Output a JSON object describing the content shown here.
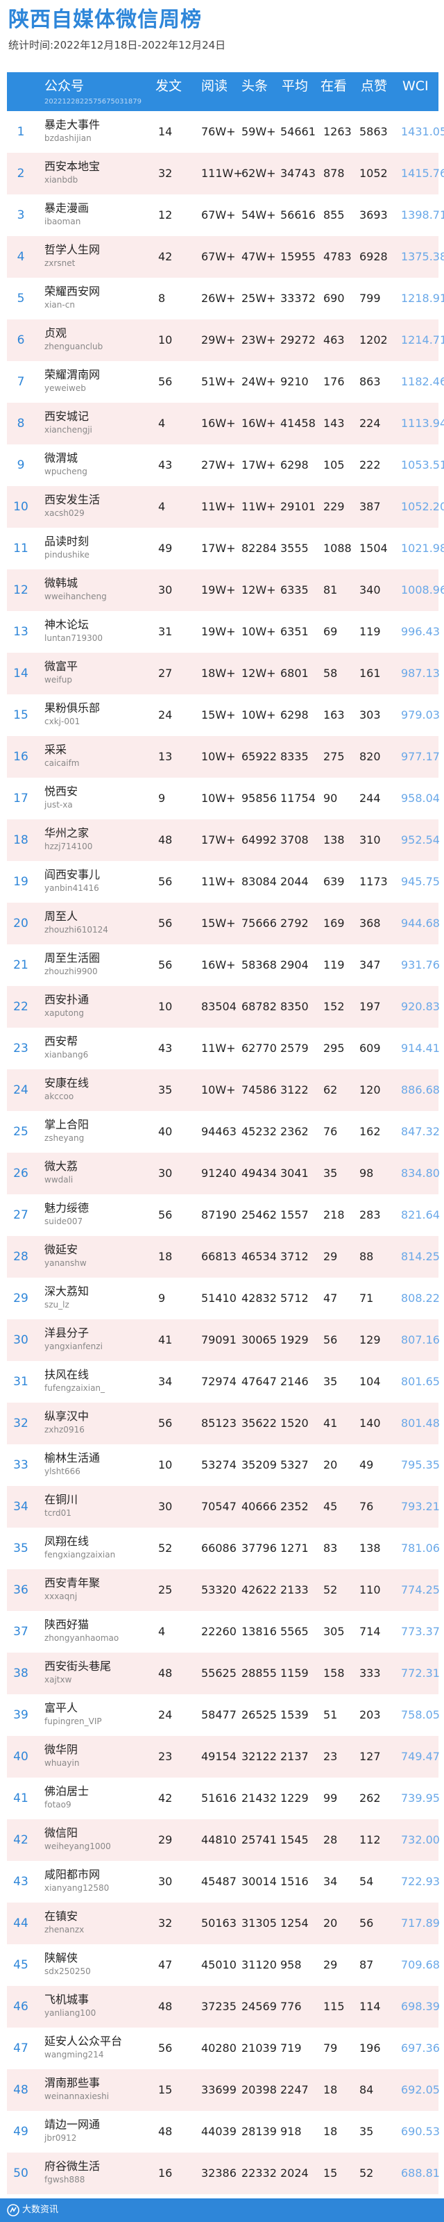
{
  "title": "陕西自媒体微信周榜",
  "subtitle": "统计时间:2022年12月18日-2022年12月24日",
  "header": {
    "account": "公众号",
    "account_sub": "2022122822575675031879",
    "post": "发文",
    "read": "阅读",
    "head": "头条",
    "avg": "平均",
    "like": "在看",
    "zan": "点赞",
    "wci": "WCI"
  },
  "rows": [
    {
      "rank": "1",
      "name": "暴走大事件",
      "id": "bzdashijian",
      "post": "14",
      "read": "76W+",
      "head": "59W+",
      "avg": "54661",
      "like": "1263",
      "zan": "5863",
      "wci": "1431.05"
    },
    {
      "rank": "2",
      "name": "西安本地宝",
      "id": "xianbdb",
      "post": "32",
      "read": "111W+",
      "head": "62W+",
      "avg": "34743",
      "like": "878",
      "zan": "1052",
      "wci": "1415.76"
    },
    {
      "rank": "3",
      "name": "暴走漫画",
      "id": "ibaoman",
      "post": "12",
      "read": "67W+",
      "head": "54W+",
      "avg": "56616",
      "like": "855",
      "zan": "3693",
      "wci": "1398.71"
    },
    {
      "rank": "4",
      "name": "哲学人生网",
      "id": "zxrsnet",
      "post": "42",
      "read": "67W+",
      "head": "47W+",
      "avg": "15955",
      "like": "4783",
      "zan": "6928",
      "wci": "1375.38"
    },
    {
      "rank": "5",
      "name": "荣耀西安网",
      "id": "xian-cn",
      "post": "8",
      "read": "26W+",
      "head": "25W+",
      "avg": "33372",
      "like": "690",
      "zan": "799",
      "wci": "1218.91"
    },
    {
      "rank": "6",
      "name": "贞观",
      "id": "zhenguanclub",
      "post": "10",
      "read": "29W+",
      "head": "23W+",
      "avg": "29272",
      "like": "463",
      "zan": "1202",
      "wci": "1214.71"
    },
    {
      "rank": "7",
      "name": "荣耀渭南网",
      "id": "yeweiweb",
      "post": "56",
      "read": "51W+",
      "head": "24W+",
      "avg": "9210",
      "like": "176",
      "zan": "863",
      "wci": "1182.46"
    },
    {
      "rank": "8",
      "name": "西安城记",
      "id": "xianchengji",
      "post": "4",
      "read": "16W+",
      "head": "16W+",
      "avg": "41458",
      "like": "143",
      "zan": "224",
      "wci": "1113.94"
    },
    {
      "rank": "9",
      "name": "微渭城",
      "id": "wpucheng",
      "post": "43",
      "read": "27W+",
      "head": "17W+",
      "avg": "6298",
      "like": "105",
      "zan": "222",
      "wci": "1053.51"
    },
    {
      "rank": "10",
      "name": "西安发生活",
      "id": "xacsh029",
      "post": "4",
      "read": "11W+",
      "head": "11W+",
      "avg": "29101",
      "like": "229",
      "zan": "387",
      "wci": "1052.20"
    },
    {
      "rank": "11",
      "name": "品读时刻",
      "id": "pindushike",
      "post": "49",
      "read": "17W+",
      "head": "82284",
      "avg": "3555",
      "like": "1088",
      "zan": "1504",
      "wci": "1021.98"
    },
    {
      "rank": "12",
      "name": "微韩城",
      "id": "wweihancheng",
      "post": "30",
      "read": "19W+",
      "head": "12W+",
      "avg": "6335",
      "like": "81",
      "zan": "340",
      "wci": "1008.96"
    },
    {
      "rank": "13",
      "name": "神木论坛",
      "id": "luntan719300",
      "post": "31",
      "read": "19W+",
      "head": "10W+",
      "avg": "6351",
      "like": "69",
      "zan": "119",
      "wci": "996.43"
    },
    {
      "rank": "14",
      "name": "微富平",
      "id": "weifup",
      "post": "27",
      "read": "18W+",
      "head": "12W+",
      "avg": "6801",
      "like": "58",
      "zan": "161",
      "wci": "987.13"
    },
    {
      "rank": "15",
      "name": "果粉俱乐部",
      "id": "cxkj-001",
      "post": "24",
      "read": "15W+",
      "head": "10W+",
      "avg": "6298",
      "like": "163",
      "zan": "303",
      "wci": "979.03"
    },
    {
      "rank": "16",
      "name": "采采",
      "id": "caicaifm",
      "post": "13",
      "read": "10W+",
      "head": "65922",
      "avg": "8335",
      "like": "275",
      "zan": "820",
      "wci": "977.17"
    },
    {
      "rank": "17",
      "name": "悦西安",
      "id": "just-xa",
      "post": "9",
      "read": "10W+",
      "head": "95856",
      "avg": "11754",
      "like": "90",
      "zan": "244",
      "wci": "958.04"
    },
    {
      "rank": "18",
      "name": "华州之家",
      "id": "hzzj714100",
      "post": "48",
      "read": "17W+",
      "head": "64992",
      "avg": "3708",
      "like": "138",
      "zan": "310",
      "wci": "952.54"
    },
    {
      "rank": "19",
      "name": "阎西安事儿",
      "id": "yanbin41416",
      "post": "56",
      "read": "11W+",
      "head": "83084",
      "avg": "2044",
      "like": "639",
      "zan": "1173",
      "wci": "945.75"
    },
    {
      "rank": "20",
      "name": "周至人",
      "id": "zhouzhi610124",
      "post": "56",
      "read": "15W+",
      "head": "75666",
      "avg": "2792",
      "like": "169",
      "zan": "368",
      "wci": "944.68"
    },
    {
      "rank": "21",
      "name": "周至生活圈",
      "id": "zhouzhi9900",
      "post": "56",
      "read": "16W+",
      "head": "58368",
      "avg": "2904",
      "like": "119",
      "zan": "347",
      "wci": "931.76"
    },
    {
      "rank": "22",
      "name": "西安扑通",
      "id": "xaputong",
      "post": "10",
      "read": "83504",
      "head": "68782",
      "avg": "8350",
      "like": "152",
      "zan": "197",
      "wci": "920.83"
    },
    {
      "rank": "23",
      "name": "西安帮",
      "id": "xianbang6",
      "post": "43",
      "read": "11W+",
      "head": "62770",
      "avg": "2579",
      "like": "295",
      "zan": "609",
      "wci": "914.41"
    },
    {
      "rank": "24",
      "name": "安康在线",
      "id": "akccoo",
      "post": "35",
      "read": "10W+",
      "head": "74586",
      "avg": "3122",
      "like": "62",
      "zan": "120",
      "wci": "886.68"
    },
    {
      "rank": "25",
      "name": "掌上合阳",
      "id": "zsheyang",
      "post": "40",
      "read": "94463",
      "head": "45232",
      "avg": "2362",
      "like": "76",
      "zan": "162",
      "wci": "847.32"
    },
    {
      "rank": "26",
      "name": "微大荔",
      "id": "wwdali",
      "post": "30",
      "read": "91240",
      "head": "49434",
      "avg": "3041",
      "like": "35",
      "zan": "98",
      "wci": "834.80"
    },
    {
      "rank": "27",
      "name": "魅力绥德",
      "id": "suide007",
      "post": "56",
      "read": "87190",
      "head": "25462",
      "avg": "1557",
      "like": "218",
      "zan": "283",
      "wci": "821.64"
    },
    {
      "rank": "28",
      "name": "微延安",
      "id": "yananshw",
      "post": "18",
      "read": "66813",
      "head": "46534",
      "avg": "3712",
      "like": "29",
      "zan": "88",
      "wci": "814.25"
    },
    {
      "rank": "29",
      "name": "深大荔知",
      "id": "szu_lz",
      "post": "9",
      "read": "51410",
      "head": "42832",
      "avg": "5712",
      "like": "47",
      "zan": "71",
      "wci": "808.22"
    },
    {
      "rank": "30",
      "name": "洋县分子",
      "id": "yangxianfenzi",
      "post": "41",
      "read": "79091",
      "head": "30065",
      "avg": "1929",
      "like": "56",
      "zan": "129",
      "wci": "807.16"
    },
    {
      "rank": "31",
      "name": "扶风在线",
      "id": "fufengzaixian_",
      "post": "34",
      "read": "72974",
      "head": "47647",
      "avg": "2146",
      "like": "35",
      "zan": "104",
      "wci": "801.65"
    },
    {
      "rank": "32",
      "name": "纵享汉中",
      "id": "zxhz0916",
      "post": "56",
      "read": "85123",
      "head": "35622",
      "avg": "1520",
      "like": "41",
      "zan": "140",
      "wci": "801.48"
    },
    {
      "rank": "33",
      "name": "榆林生活通",
      "id": "ylsht666",
      "post": "10",
      "read": "53274",
      "head": "35209",
      "avg": "5327",
      "like": "20",
      "zan": "49",
      "wci": "795.35"
    },
    {
      "rank": "34",
      "name": "在铜川",
      "id": "tcrd01",
      "post": "30",
      "read": "70547",
      "head": "40666",
      "avg": "2352",
      "like": "45",
      "zan": "76",
      "wci": "793.21"
    },
    {
      "rank": "35",
      "name": "凤翔在线",
      "id": "fengxiangzaixian",
      "post": "52",
      "read": "66086",
      "head": "37796",
      "avg": "1271",
      "like": "83",
      "zan": "138",
      "wci": "781.06"
    },
    {
      "rank": "36",
      "name": "西安青年聚",
      "id": "xxxaqnj",
      "post": "25",
      "read": "53320",
      "head": "42622",
      "avg": "2133",
      "like": "52",
      "zan": "110",
      "wci": "774.25"
    },
    {
      "rank": "37",
      "name": "陕西好猫",
      "id": "zhongyanhaomao",
      "post": "4",
      "read": "22260",
      "head": "13816",
      "avg": "5565",
      "like": "305",
      "zan": "714",
      "wci": "773.37"
    },
    {
      "rank": "38",
      "name": "西安街头巷尾",
      "id": "xajtxw",
      "post": "48",
      "read": "55625",
      "head": "28855",
      "avg": "1159",
      "like": "158",
      "zan": "333",
      "wci": "772.31"
    },
    {
      "rank": "39",
      "name": "富平人",
      "id": "fupingren_VIP",
      "post": "24",
      "read": "58477",
      "head": "26525",
      "avg": "1539",
      "like": "51",
      "zan": "203",
      "wci": "758.05"
    },
    {
      "rank": "40",
      "name": "微华阴",
      "id": "whuayin",
      "post": "23",
      "read": "49154",
      "head": "32122",
      "avg": "2137",
      "like": "23",
      "zan": "127",
      "wci": "749.47"
    },
    {
      "rank": "41",
      "name": "佛泊居士",
      "id": "fotao9",
      "post": "42",
      "read": "51616",
      "head": "21432",
      "avg": "1229",
      "like": "99",
      "zan": "262",
      "wci": "739.95"
    },
    {
      "rank": "42",
      "name": "微信阳",
      "id": "weiheyang1000",
      "post": "29",
      "read": "44810",
      "head": "25741",
      "avg": "1545",
      "like": "28",
      "zan": "112",
      "wci": "732.00"
    },
    {
      "rank": "43",
      "name": "咸阳都市网",
      "id": "xianyang12580",
      "post": "30",
      "read": "45487",
      "head": "30014",
      "avg": "1516",
      "like": "34",
      "zan": "54",
      "wci": "722.93"
    },
    {
      "rank": "44",
      "name": "在镇安",
      "id": "zhenanzx",
      "post": "32",
      "read": "50163",
      "head": "31305",
      "avg": "1254",
      "like": "20",
      "zan": "56",
      "wci": "717.89"
    },
    {
      "rank": "45",
      "name": "陕解侠",
      "id": "sdx250250",
      "post": "47",
      "read": "45010",
      "head": "31120",
      "avg": "958",
      "like": "29",
      "zan": "87",
      "wci": "709.68"
    },
    {
      "rank": "46",
      "name": "飞机城事",
      "id": "yanliang100",
      "post": "48",
      "read": "37235",
      "head": "24569",
      "avg": "776",
      "like": "115",
      "zan": "114",
      "wci": "698.39"
    },
    {
      "rank": "47",
      "name": "延安人公众平台",
      "id": "wangming214",
      "post": "56",
      "read": "40280",
      "head": "21039",
      "avg": "719",
      "like": "79",
      "zan": "196",
      "wci": "697.36"
    },
    {
      "rank": "48",
      "name": "渭南那些事",
      "id": "weinannaxieshi",
      "post": "15",
      "read": "33699",
      "head": "20398",
      "avg": "2247",
      "like": "18",
      "zan": "84",
      "wci": "692.05"
    },
    {
      "rank": "49",
      "name": "靖边一网通",
      "id": "jbr0912",
      "post": "48",
      "read": "44039",
      "head": "28139",
      "avg": "918",
      "like": "18",
      "zan": "35",
      "wci": "690.53"
    },
    {
      "rank": "50",
      "name": "府谷微生活",
      "id": "fgwsh888",
      "post": "16",
      "read": "32386",
      "head": "22332",
      "avg": "2024",
      "like": "15",
      "zan": "52",
      "wci": "688.81"
    }
  ],
  "footer": {
    "text": "大数资讯",
    "logo_icon": "brand-logo-icon"
  },
  "colors": {
    "brand": "#2e86d9",
    "alt_row": "#fbecec",
    "wci": "#6aa8e8"
  }
}
